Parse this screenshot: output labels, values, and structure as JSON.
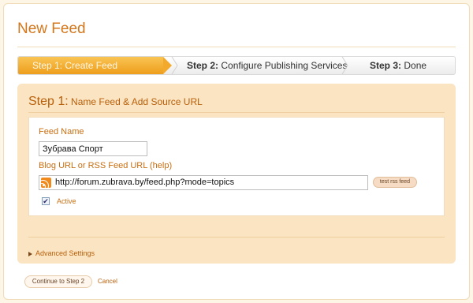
{
  "page": {
    "title": "New Feed"
  },
  "steps": [
    {
      "label_num": "Step 1:",
      "label_text": "Create Feed",
      "state": "active"
    },
    {
      "label_num": "Step 2:",
      "label_text": "Configure Publishing Services",
      "state": "inactive"
    },
    {
      "label_num": "Step 3:",
      "label_text": "Done",
      "state": "inactive"
    }
  ],
  "panel": {
    "heading_num": "Step 1:",
    "heading_text": "Name Feed & Add Source URL",
    "feed_name_label": "Feed Name",
    "feed_name_value": "Зубрава Спорт",
    "url_label": "Blog URL or RSS Feed URL (help)",
    "url_value": "http://forum.zubrava.by/feed.php?mode=topics",
    "url_icon": "rss-icon",
    "test_button_label": "test rss feed",
    "active_checked": "✔",
    "active_label": "Active",
    "advanced_label": "Advanced Settings"
  },
  "footer": {
    "continue_label": "Continue to Step 2",
    "cancel_label": "Cancel"
  },
  "colors": {
    "accent": "#d4761a",
    "active_step": "#f2a92c",
    "panel_bg": "#fbe4c2"
  }
}
